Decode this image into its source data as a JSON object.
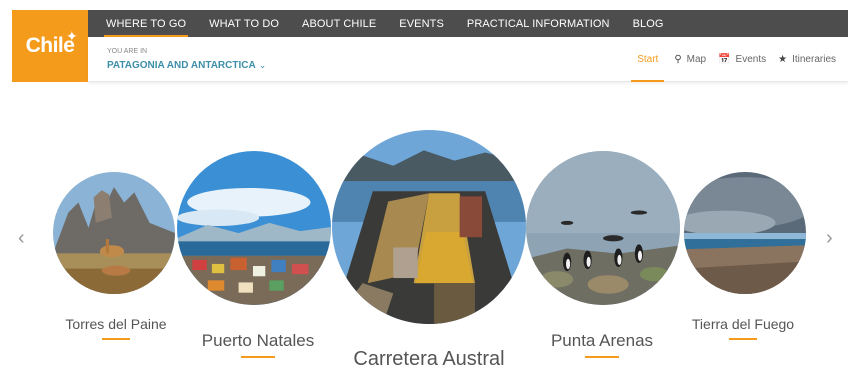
{
  "brand": {
    "logo_text": "Chile",
    "accent": "#f59b1c",
    "nav_bg": "#4d4d4d",
    "region_color": "#3d8fa8"
  },
  "topnav": [
    {
      "label": "WHERE TO GO"
    },
    {
      "label": "WHAT TO DO"
    },
    {
      "label": "ABOUT CHILE"
    },
    {
      "label": "EVENTS"
    },
    {
      "label": "PRACTICAL INFORMATION"
    },
    {
      "label": "BLOG"
    }
  ],
  "subbar": {
    "you_are_in": "YOU ARE IN",
    "region": "PATAGONIA AND ANTARCTICA"
  },
  "tabs": [
    {
      "label": "Start",
      "icon": "none"
    },
    {
      "label": "Map",
      "icon": "map-pin-icon"
    },
    {
      "label": "Events",
      "icon": "calendar-icon"
    },
    {
      "label": "Itineraries",
      "icon": "star-icon"
    }
  ],
  "carousel": {
    "prev_icon": "chevron-left-icon",
    "next_icon": "chevron-right-icon",
    "destinations": [
      {
        "name": "Torres del Paine",
        "image": "guanacos-and-granite-towers"
      },
      {
        "name": "Puerto Natales",
        "image": "colorful-town-by-fjord"
      },
      {
        "name": "Carretera Austral",
        "image": "ferry-deck-with-vehicles"
      },
      {
        "name": "Punta Arenas",
        "image": "penguins-on-rocky-shore"
      },
      {
        "name": "Tierra del Fuego",
        "image": "beach-under-cloudy-sky"
      }
    ]
  }
}
